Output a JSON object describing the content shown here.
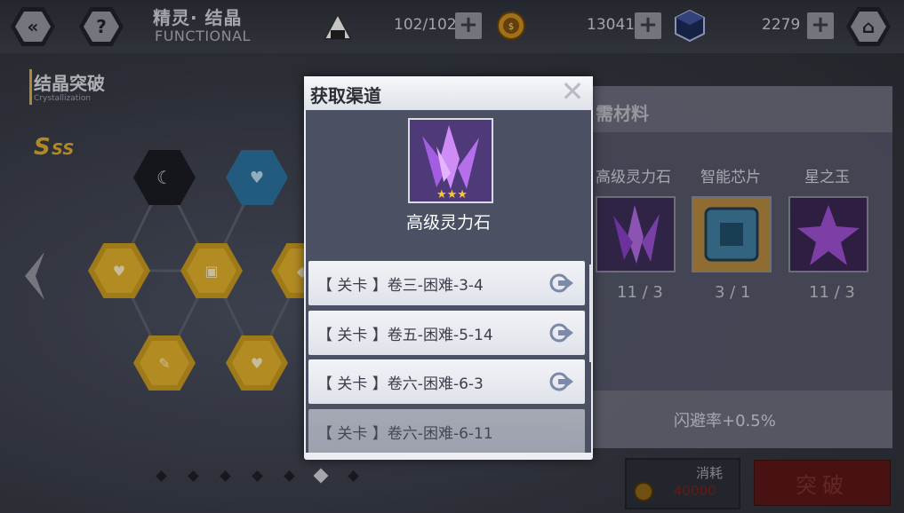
{
  "header": {
    "title_cn": "精灵· 结晶",
    "title_en": "FUNCTIONAL",
    "stamina": "102/102",
    "coins": "13041",
    "gems": "2279"
  },
  "left": {
    "section_title": "结晶突破",
    "section_sub": "Crystallization",
    "rank_badge": "S级"
  },
  "materials": {
    "header": "需材料",
    "items": [
      {
        "name": "高级灵力石",
        "count": "11 / 3"
      },
      {
        "name": "智能芯片",
        "count": "3 / 1"
      },
      {
        "name": "星之玉",
        "count": "11 / 3"
      }
    ],
    "effect": "闪避率+0.5%"
  },
  "cost": {
    "label": "消耗",
    "value": "40000"
  },
  "break_button": "突破",
  "modal": {
    "title": "获取渠道",
    "item_name": "高级灵力石",
    "routes": [
      "【 关卡 】卷三-困难-3-4",
      "【 关卡 】卷五-困难-5-14",
      "【 关卡 】卷六-困难-6-3",
      "【 关卡 】卷六-困难-6-11"
    ]
  },
  "colors": {
    "gold_node": "#c2951f",
    "crystal_purple": "#9b3fd6",
    "break_red": "#5a1616"
  }
}
